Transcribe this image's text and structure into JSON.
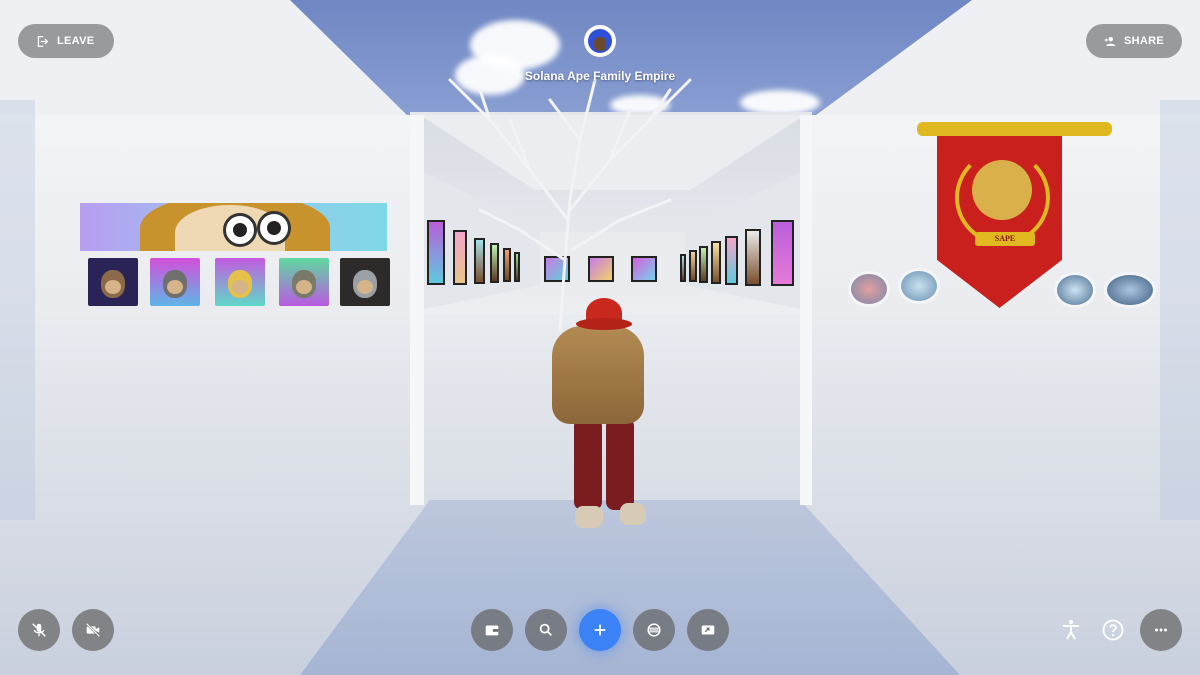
{
  "header": {
    "leave_label": "LEAVE",
    "share_label": "SHARE",
    "room_title": "Solana Ape Family Empire"
  },
  "scene": {
    "pennant_text": "SAPE"
  },
  "toolbar_left": [
    {
      "icon": "mic-off-icon"
    },
    {
      "icon": "camera-off-icon"
    }
  ],
  "toolbar_center": [
    {
      "icon": "wallet-icon"
    },
    {
      "icon": "search-icon"
    },
    {
      "icon": "plus-icon"
    },
    {
      "icon": "globe-icon"
    },
    {
      "icon": "screen-share-icon"
    }
  ],
  "toolbar_right": [
    {
      "icon": "accessibility-icon"
    },
    {
      "icon": "help-icon"
    },
    {
      "icon": "more-icon"
    }
  ],
  "colors": {
    "accent": "#3b82f6",
    "pill_bg": "#787878",
    "pennant": "#c9201d"
  }
}
